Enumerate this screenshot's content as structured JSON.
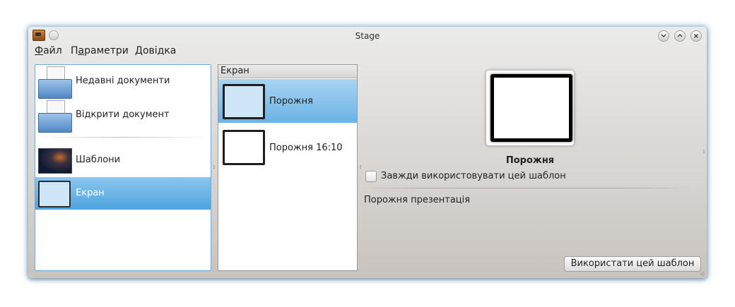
{
  "window": {
    "title": "Stage",
    "buttons": [
      "chevron-down-icon",
      "chevron-up-icon",
      "close-icon"
    ]
  },
  "menubar": {
    "items": [
      {
        "accel": "Ф",
        "rest": "айл"
      },
      {
        "prefix": "П",
        "accel": "а",
        "rest": "раметри"
      },
      {
        "accel": "Д",
        "rest": "овідка"
      }
    ]
  },
  "left_panel": {
    "items": [
      {
        "label": "Недавні документи",
        "icon": "recent-documents-icon"
      },
      {
        "label": "Відкрити документ",
        "icon": "open-document-icon"
      },
      {
        "label": "Шаблони",
        "icon": "templates-thumbnail"
      },
      {
        "label": "Екран",
        "icon": "screen-thumbnail",
        "selected": true
      }
    ]
  },
  "middle_panel": {
    "header": "Екран",
    "templates": [
      {
        "label": "Порожня",
        "selected": true
      },
      {
        "label": "Порожня 16:10",
        "selected": false
      }
    ]
  },
  "details": {
    "template_name": "Порожня",
    "always_use_label": "Завжди використовувати цей шаблон",
    "always_use_checked": false,
    "description": "Порожня презентація",
    "use_button_label": "Використати цей шаблон"
  },
  "colors": {
    "selection": "#4ea4e0",
    "focus_border": "#6aa9dc"
  }
}
